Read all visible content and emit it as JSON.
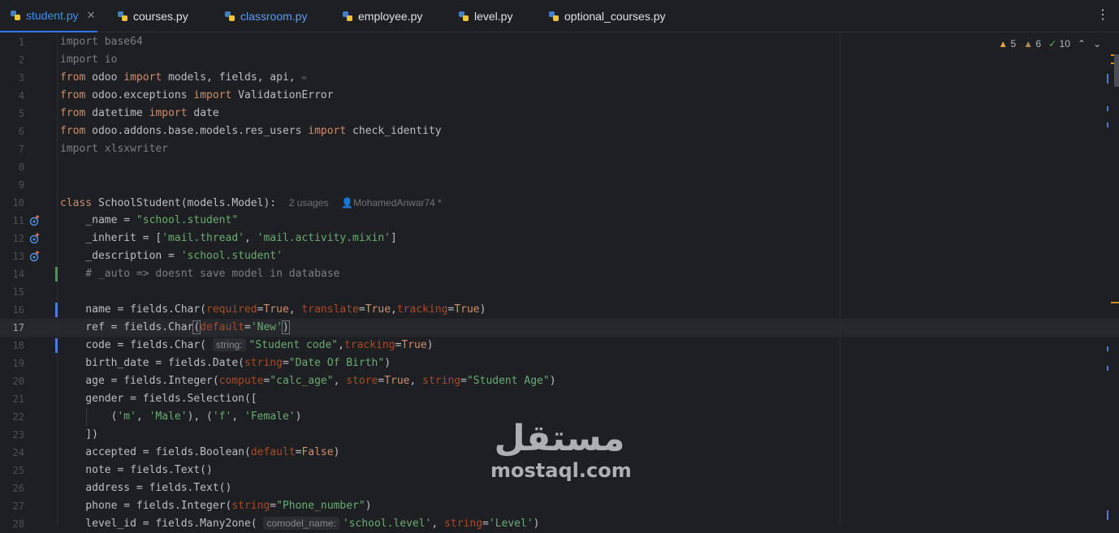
{
  "tabs": [
    {
      "label": "student.py",
      "active": true
    },
    {
      "label": "courses.py"
    },
    {
      "label": "classroom.py"
    },
    {
      "label": "employee.py"
    },
    {
      "label": "level.py"
    },
    {
      "label": "optional_courses.py"
    }
  ],
  "inspections": {
    "warnings": "5",
    "weak_warnings": "6",
    "ok": "10"
  },
  "editor": {
    "current_line": "17",
    "line_numbers": [
      "1",
      "2",
      "3",
      "4",
      "5",
      "6",
      "7",
      "8",
      "9",
      "10",
      "11",
      "12",
      "13",
      "14",
      "15",
      "16",
      "17",
      "18",
      "19",
      "20",
      "21",
      "22",
      "23",
      "24",
      "25",
      "26",
      "27",
      "28"
    ],
    "class_usages": "2 usages",
    "class_author": "MohamedAnwar74 *",
    "hints": {
      "string": "string:",
      "comodel_name": "comodel_name:"
    }
  },
  "watermark": {
    "arabic": "مستقل",
    "latin": "mostaql.com"
  },
  "colors": {
    "background": "#1e1f22",
    "keyword": "#cf8e6d",
    "string": "#6aab73",
    "param": "#aa4926",
    "accent": "#3574f0",
    "changed_line": "#4f7ad9",
    "added_line": "#549159"
  }
}
